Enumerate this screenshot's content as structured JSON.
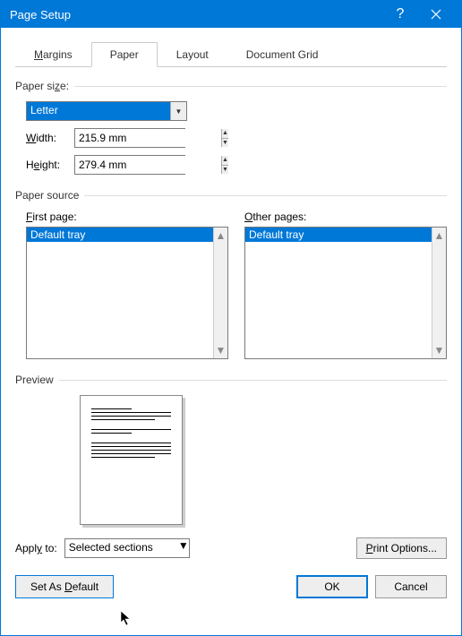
{
  "title": "Page Setup",
  "tabs": {
    "margins": "Margins",
    "paper": "Paper",
    "layout": "Layout",
    "docgrid": "Document Grid"
  },
  "paperSize": {
    "label": "Paper size:",
    "value": "Letter",
    "width": {
      "label": "Width:",
      "value": "215.9 mm"
    },
    "height": {
      "label": "Height:",
      "value": "279.4 mm"
    }
  },
  "paperSource": {
    "label": "Paper source",
    "first": {
      "label": "First page:",
      "item": "Default tray"
    },
    "other": {
      "label": "Other pages:",
      "item": "Default tray"
    }
  },
  "preview": {
    "label": "Preview"
  },
  "applyTo": {
    "label": "Apply to:",
    "value": "Selected sections"
  },
  "printOptions": "Print Options...",
  "buttons": {
    "setDefault": "Set As Default",
    "ok": "OK",
    "cancel": "Cancel"
  }
}
